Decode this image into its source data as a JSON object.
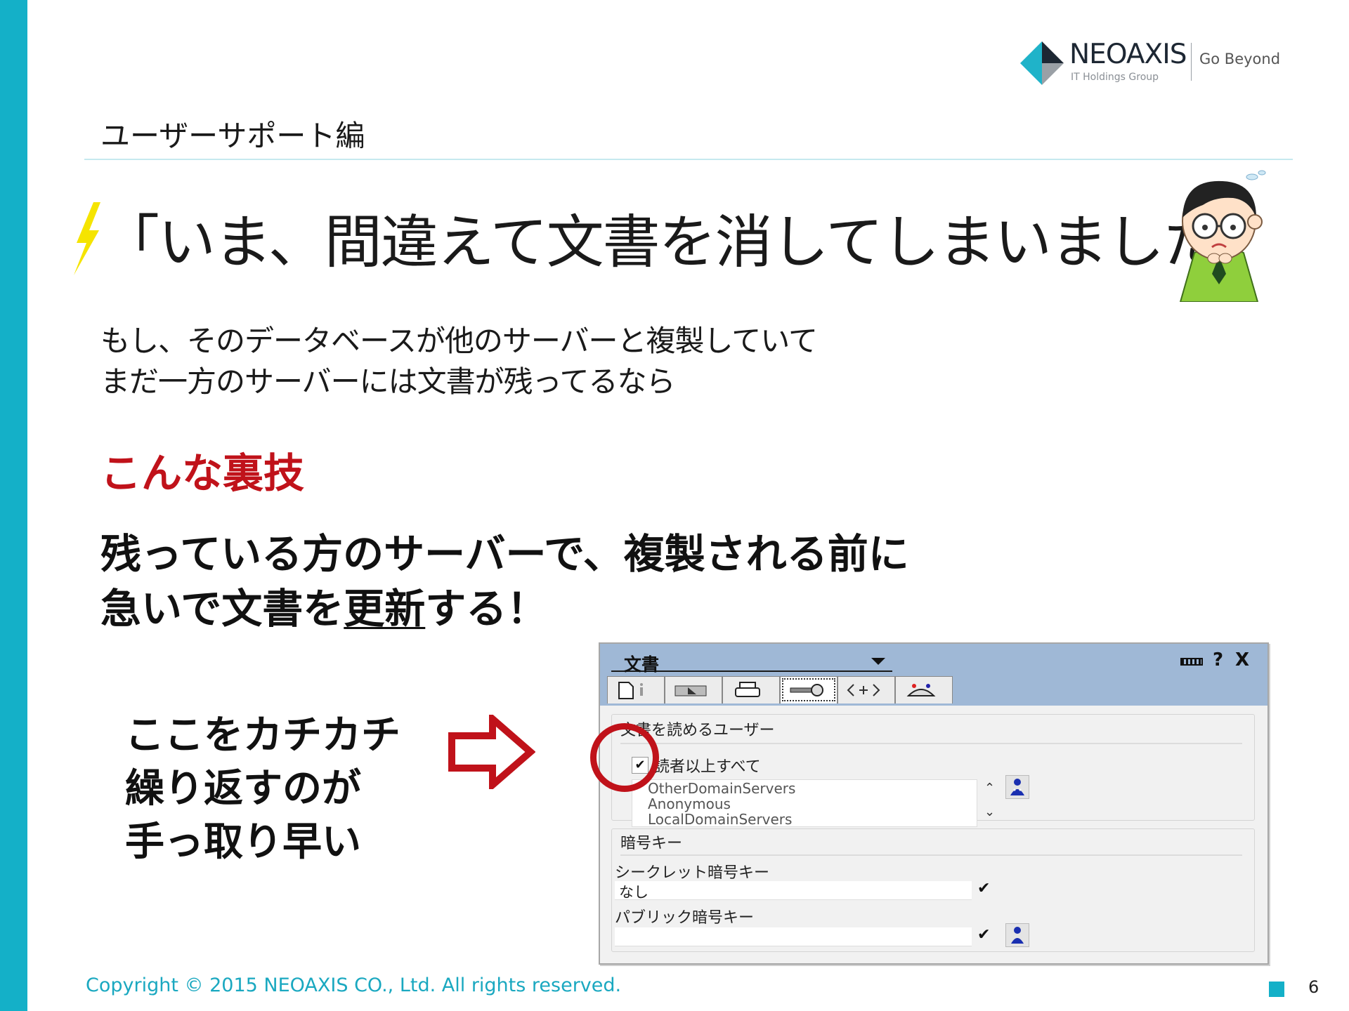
{
  "brand": {
    "name": "NEOAXIS",
    "group": "IT Holdings Group",
    "tagline": "Go Beyond",
    "accent_color": "#14b0c8"
  },
  "section_title": "ユーザーサポート編",
  "main_title": "「いま、間違えて文書を消してしまいました」",
  "lead": {
    "line1": "もし、そのデータベースが他のサーバーと複製していて",
    "line2": "まだ一方のサーバーには文書が残ってるなら"
  },
  "trick_heading": "こんな裏技",
  "tip": {
    "line1": "残っている方のサーバーで、複製される前に",
    "line2_prefix": "急いで文書を",
    "line2_emphasis": "更新",
    "line2_suffix": "する！"
  },
  "note": {
    "line1": "ここをカチカチ",
    "line2": "繰り返すのが",
    "line3": "手っ取り早い"
  },
  "dialog": {
    "title": "文書",
    "controls": {
      "help": "?",
      "close": "X"
    },
    "tab_icons": [
      "document-info-icon",
      "ruler-icon",
      "printer-icon",
      "key-icon",
      "html-tag-icon",
      "hat-icon"
    ],
    "readers_label": "文書を読めるユーザー",
    "readers_all_label": "読者以上すべて",
    "readers_all_checked": true,
    "check_mark": "✔",
    "readers_list": [
      "OtherDomainServers",
      "Anonymous",
      "LocalDomainServers"
    ],
    "keys_label": "暗号キー",
    "secret_key_label": "シークレット暗号キー",
    "secret_key_value": "なし",
    "public_key_label": "パブリック暗号キー",
    "public_key_value": ""
  },
  "footer": {
    "copyright": "Copyright © 2015 NEOAXIS CO., Ltd. All rights reserved.",
    "page_number": "6"
  },
  "colors": {
    "emphasis_red": "#c0121a",
    "bolt_yellow": "#f5e400",
    "dialog_header": "#9fb8d6"
  }
}
